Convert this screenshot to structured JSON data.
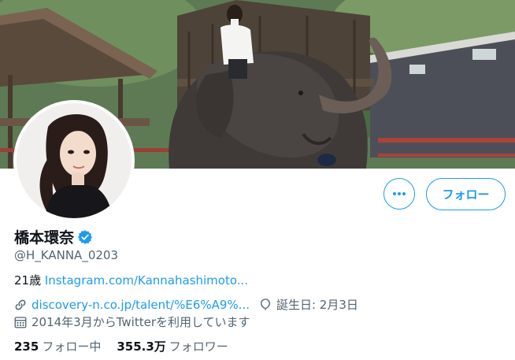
{
  "profile": {
    "name": "橋本環奈",
    "handle": "@H_KANNA_0203",
    "bio_prefix": "21歳 ",
    "bio_link": "Instagram.com/Kannahashimoto...",
    "website": "discovery-n.co.jp/talent/%E6%A9%...",
    "birthday": "誕生日: 2月3日",
    "joined": "2014年3月からTwitterを利用しています"
  },
  "stats": {
    "following_count": "235",
    "following_label": "フォロー中",
    "followers_count": "355.3万",
    "followers_label": "フォロワー"
  },
  "buttons": {
    "more_label": "•••",
    "follow_label": "フォロー"
  },
  "icons": {
    "more": "more-icon",
    "verified": "verified-badge-icon",
    "link": "link-icon",
    "balloon": "balloon-icon",
    "calendar": "calendar-icon"
  },
  "colors": {
    "accent": "#1d9bf0",
    "muted_text": "#536471",
    "text": "#0f1419"
  }
}
